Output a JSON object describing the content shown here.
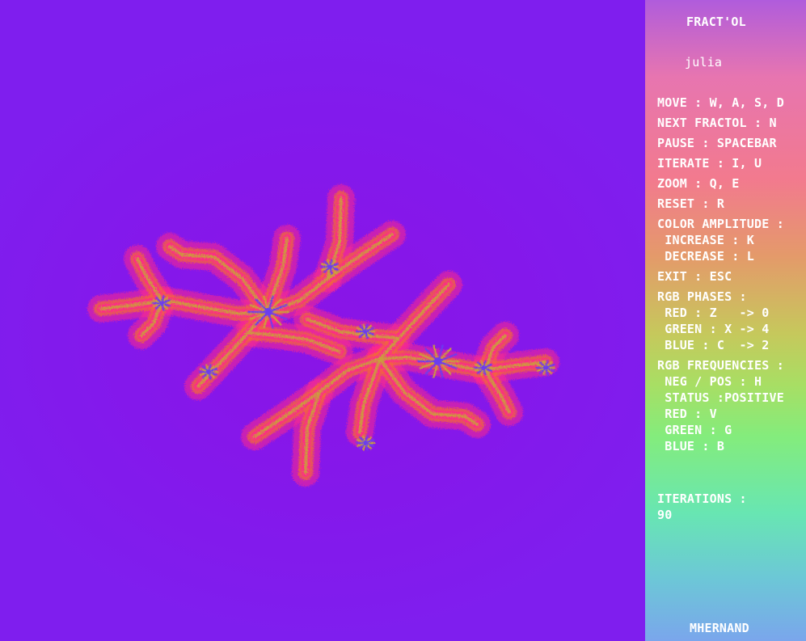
{
  "window": {
    "app_title": "FRACT'OL",
    "fractal_name": "julia",
    "author": "MHERNAND"
  },
  "controls": {
    "move": "MOVE : W, A, S, D",
    "next_fractol": "NEXT FRACTOL : N",
    "pause": "PAUSE : SPACEBAR",
    "iterate": "ITERATE : I, U",
    "zoom": "ZOOM : Q, E",
    "reset": "RESET : R",
    "color_amplitude": "COLOR AMPLITUDE :",
    "increase": " INCREASE : K",
    "decrease": " DECREASE : L",
    "exit": "EXIT : ESC",
    "rgb_phases": "RGB PHASES :",
    "phase_red": " RED : Z   -> 0",
    "phase_green": " GREEN : X -> 4",
    "phase_blue": " BLUE : C  -> 2",
    "rgb_frequencies": "RGB FREQUENCIES :",
    "neg_pos": " NEG / POS : H",
    "status": " STATUS :POSITIVE",
    "freq_red": " RED : V",
    "freq_green": " GREEN : G",
    "freq_blue": " BLUE : B"
  },
  "iterations": {
    "label": "ITERATIONS :",
    "value": "90"
  },
  "colors": {
    "background": "#7f1eee",
    "fractal_outer": "#ff2a8a",
    "fractal_mid": "#f06a3a",
    "fractal_detail": "#c9a23a",
    "fractal_core": "#6a3cf0"
  }
}
